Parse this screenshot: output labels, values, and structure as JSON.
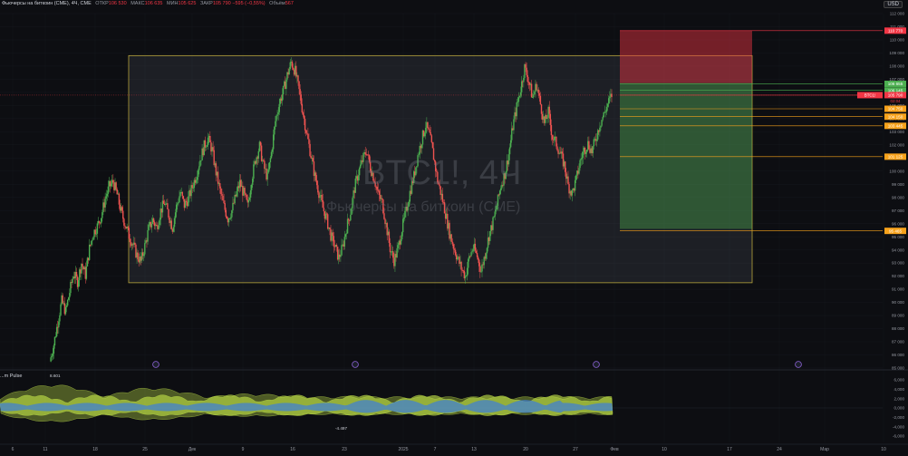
{
  "header": {
    "symbol_title": "Фьючерсы на биткоин (CME), 4Ч, CME",
    "open_label": "ОТКР",
    "open_value": "106 530",
    "high_label": "МАКС",
    "high_value": "106 635",
    "low_label": "МИН",
    "low_value": "105 625",
    "close_label": "ЗАКР",
    "close_value": "105 790",
    "change_value": "−595 (−0,55%)",
    "volume_label": "Объём",
    "volume_value": "567"
  },
  "currency_button": "USD",
  "watermark": {
    "symbol": "BTC1!, 4Ч",
    "description": "Фьючерсы на биткоин (CME)"
  },
  "indicator": {
    "name": "...m Pulse",
    "max_label": "8.601",
    "min_label": "-4.497"
  },
  "colors": {
    "background": "#0d0e12",
    "bull": "#4caf50",
    "bear": "#ef5350",
    "range_box": "#b8a43c",
    "stop_zone": "#f23645",
    "target_zone": "#4caf50",
    "level_line": "#f7a21b",
    "pulse_green": "#c6e84a",
    "pulse_blue": "#3d7fd9"
  },
  "chart_data": [
    {
      "type": "candlestick",
      "title": "Фьючерсы на биткоин (CME), 4Ч, CME",
      "xlabel": "",
      "ylabel": "",
      "ylim": [
        85000,
        112000
      ],
      "price_axis_ticks": [
        "112 000",
        "111 000",
        "110 000",
        "109 000",
        "108 000",
        "107 000",
        "106 000",
        "105 000",
        "104 000",
        "103 000",
        "102 000",
        "101 000",
        "100 000",
        "99 000",
        "98 000",
        "97 000",
        "96 000",
        "95 000",
        "94 000",
        "93 000",
        "92 000",
        "91 000",
        "90 000",
        "89 000",
        "88 000",
        "87 000",
        "86 000",
        "85 000"
      ],
      "date_axis_ticks": [
        "6",
        "11",
        "18",
        "25",
        "Дек",
        "9",
        "16",
        "23",
        "2025",
        "7",
        "13",
        "20",
        "27",
        "Фев",
        "10",
        "17",
        "24",
        "Мар",
        "10"
      ],
      "price_path": [
        85500,
        86800,
        88500,
        90100,
        89300,
        90800,
        92200,
        91600,
        93000,
        92100,
        94100,
        95300,
        95800,
        96600,
        97900,
        98800,
        99200,
        98200,
        96900,
        96000,
        95100,
        94400,
        93600,
        93100,
        94300,
        95600,
        96300,
        95700,
        97000,
        97600,
        96700,
        95700,
        97300,
        98400,
        97400,
        97900,
        98800,
        99700,
        100900,
        101900,
        102500,
        101600,
        99900,
        98500,
        97300,
        96400,
        97000,
        98100,
        99100,
        98300,
        97300,
        99400,
        100900,
        101900,
        100400,
        99500,
        101400,
        103800,
        105200,
        106100,
        107300,
        108300,
        107600,
        106100,
        104400,
        102700,
        101200,
        99600,
        98400,
        97200,
        96300,
        95100,
        94300,
        93400,
        94200,
        95700,
        96900,
        98700,
        99900,
        100800,
        101600,
        100300,
        99400,
        98200,
        97600,
        95900,
        94100,
        93200,
        94100,
        95600,
        96900,
        98400,
        99600,
        101200,
        102400,
        103500,
        102700,
        101100,
        99300,
        98100,
        96800,
        95300,
        94300,
        93400,
        92600,
        92000,
        93400,
        94200,
        93500,
        92400,
        93700,
        95100,
        96100,
        97400,
        98900,
        99800,
        101300,
        103400,
        104900,
        106300,
        107900,
        106900,
        105600,
        106600,
        105100,
        103600,
        104500,
        102600,
        102100,
        101300,
        100500,
        98900,
        98300,
        99300,
        100700,
        101600,
        102100,
        101500,
        102500,
        103600,
        104300,
        105100,
        105800
      ],
      "rectangle_range": [
        91500,
        108800
      ],
      "position": {
        "stop": [
          106700,
          110700
        ],
        "target": [
          95600,
          106700
        ]
      },
      "levels": [
        {
          "price": 110700,
          "label": "110 770",
          "color": "#f23645"
        },
        {
          "price": 106650,
          "label": "106 655",
          "color": "#4caf50"
        },
        {
          "price": 106150,
          "label": "106 145",
          "color": "#4caf50"
        },
        {
          "price": 105790,
          "label": "105 790",
          "color": "#f23645"
        },
        {
          "price": 104750,
          "label": "104 750",
          "color": "#f7a21b"
        },
        {
          "price": 104150,
          "label": "104 150",
          "color": "#f7a21b"
        },
        {
          "price": 103450,
          "label": "103 445",
          "color": "#f7a21b"
        },
        {
          "price": 101100,
          "label": "101 125",
          "color": "#f7a21b"
        },
        {
          "price": 95450,
          "label": "95 465",
          "color": "#f7a21b"
        }
      ],
      "current_price": {
        "symbol": "BTC1!",
        "price": "105 790",
        "countdown": "02:04"
      }
    },
    {
      "type": "area",
      "title": "",
      "ylim": [
        -6000,
        6000
      ],
      "axis_ticks": [
        "6,000",
        "4,000",
        "2,000",
        "0,000",
        "-2,000",
        "-4,000",
        "-6,000"
      ],
      "labels": {
        "max": "8.601",
        "min": "-4.497"
      }
    }
  ]
}
